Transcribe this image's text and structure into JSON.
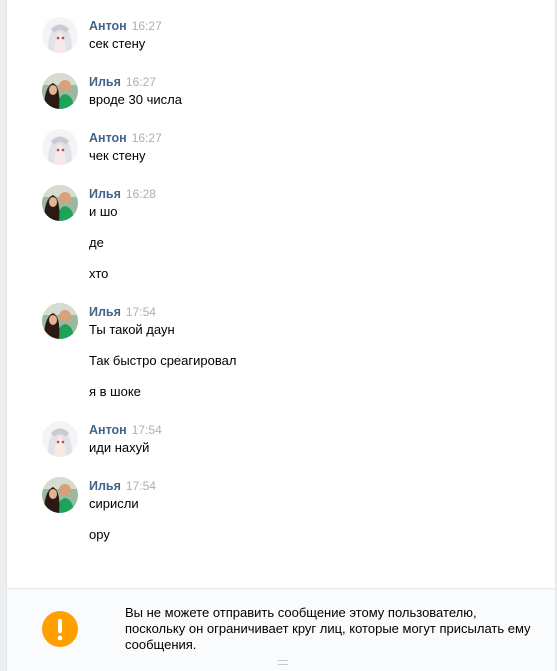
{
  "messages": [
    {
      "author": "Антон",
      "time": "16:27",
      "avatar": "anton-avatar",
      "lines": [
        "сек стену"
      ]
    },
    {
      "author": "Илья",
      "time": "16:27",
      "avatar": "ilya-avatar",
      "lines": [
        "вроде 30 числа"
      ]
    },
    {
      "author": "Антон",
      "time": "16:27",
      "avatar": "anton-avatar",
      "lines": [
        "чек стену"
      ]
    },
    {
      "author": "Илья",
      "time": "16:28",
      "avatar": "ilya-avatar",
      "lines": [
        "и шо",
        "де",
        "хто"
      ]
    },
    {
      "author": "Илья",
      "time": "17:54",
      "avatar": "ilya-avatar",
      "lines": [
        "Ты такой даун",
        "Так быстро среагировал",
        "я в шоке"
      ]
    },
    {
      "author": "Антон",
      "time": "17:54",
      "avatar": "anton-avatar",
      "lines": [
        "иди нахуй"
      ]
    },
    {
      "author": "Илья",
      "time": "17:54",
      "avatar": "ilya-avatar",
      "lines": [
        "сирисли",
        "ору"
      ]
    }
  ],
  "notice": {
    "icon": "exclamation-icon",
    "text": "Вы не можете отправить сообщение этому пользователю, поскольку он ограничивает круг лиц, которые могут присылать ему сообщения."
  },
  "colors": {
    "author": "#42648b",
    "time": "#a8b0bb",
    "warning": "#ffa000",
    "background": "#edeef0"
  }
}
